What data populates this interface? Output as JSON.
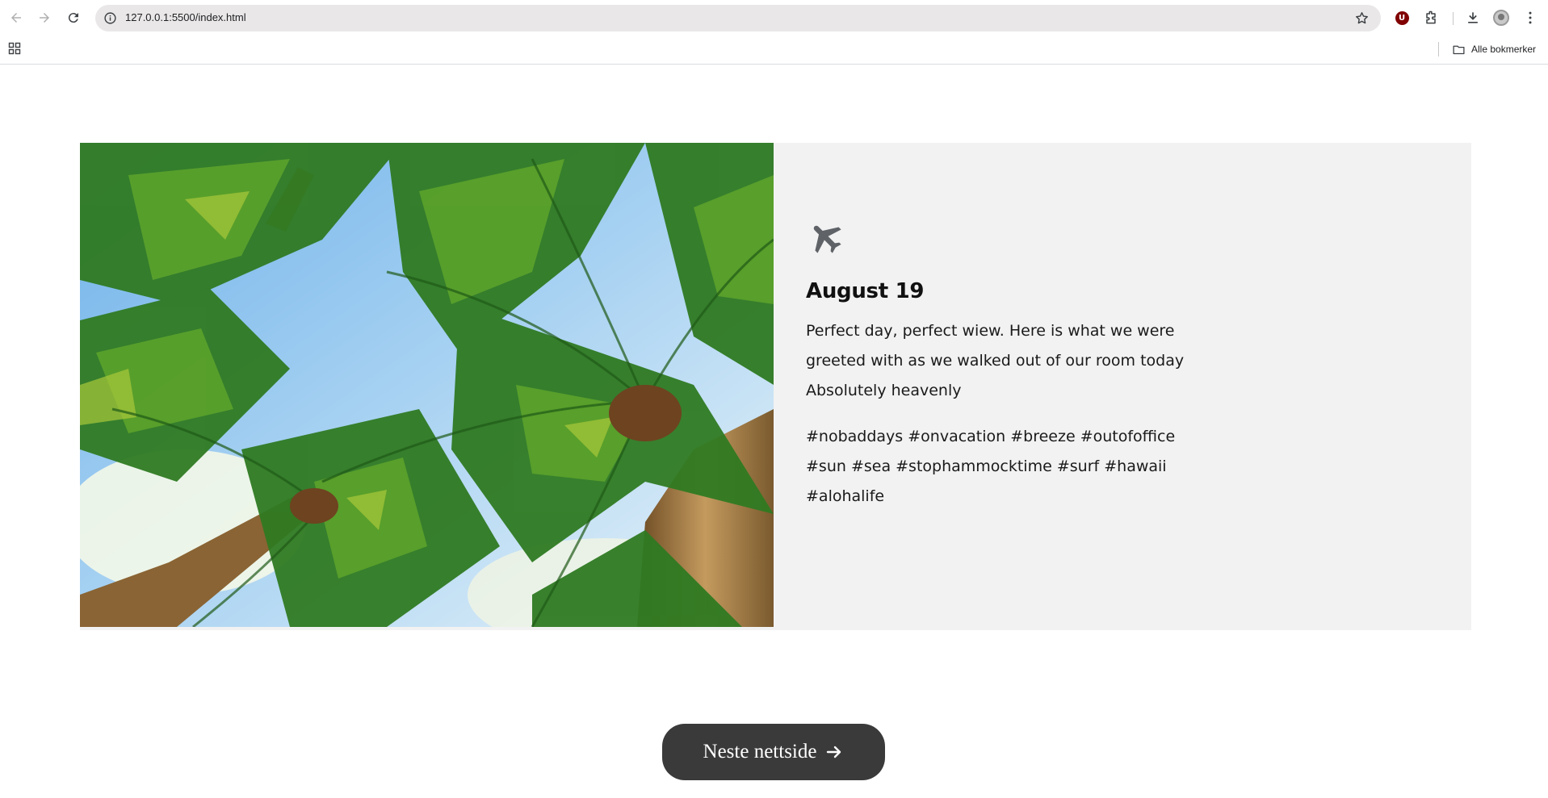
{
  "browser": {
    "url": "127.0.0.1:5500/index.html",
    "bookmarks_label": "Alle bokmerker",
    "extension_badge": "U",
    "icons": [
      "back-arrow-icon",
      "forward-arrow-icon",
      "reload-icon",
      "site-info-icon",
      "bookmark-star-icon",
      "ublock-icon",
      "extensions-icon",
      "download-icon",
      "profile-avatar",
      "more-menu-icon",
      "apps-grid-icon",
      "folder-icon"
    ]
  },
  "post": {
    "image": "palm-trees-photo",
    "icon": "airplane-icon",
    "date": "August 19",
    "text": "Perfect day, perfect wiew. Here is what we were greeted with as we walked out of our room today Absolutely heavenly",
    "tags": "#nobaddays #onvacation #breeze #outofoffice #sun #sea #stophammocktime #surf #hawaii #alohalife"
  },
  "next_button": {
    "label": "Neste nettside",
    "icon": "arrow-right-icon"
  },
  "colors": {
    "card_background": "#f2f2f2",
    "button_background": "#3a3a3a",
    "icon_gray": "#5f6368"
  }
}
